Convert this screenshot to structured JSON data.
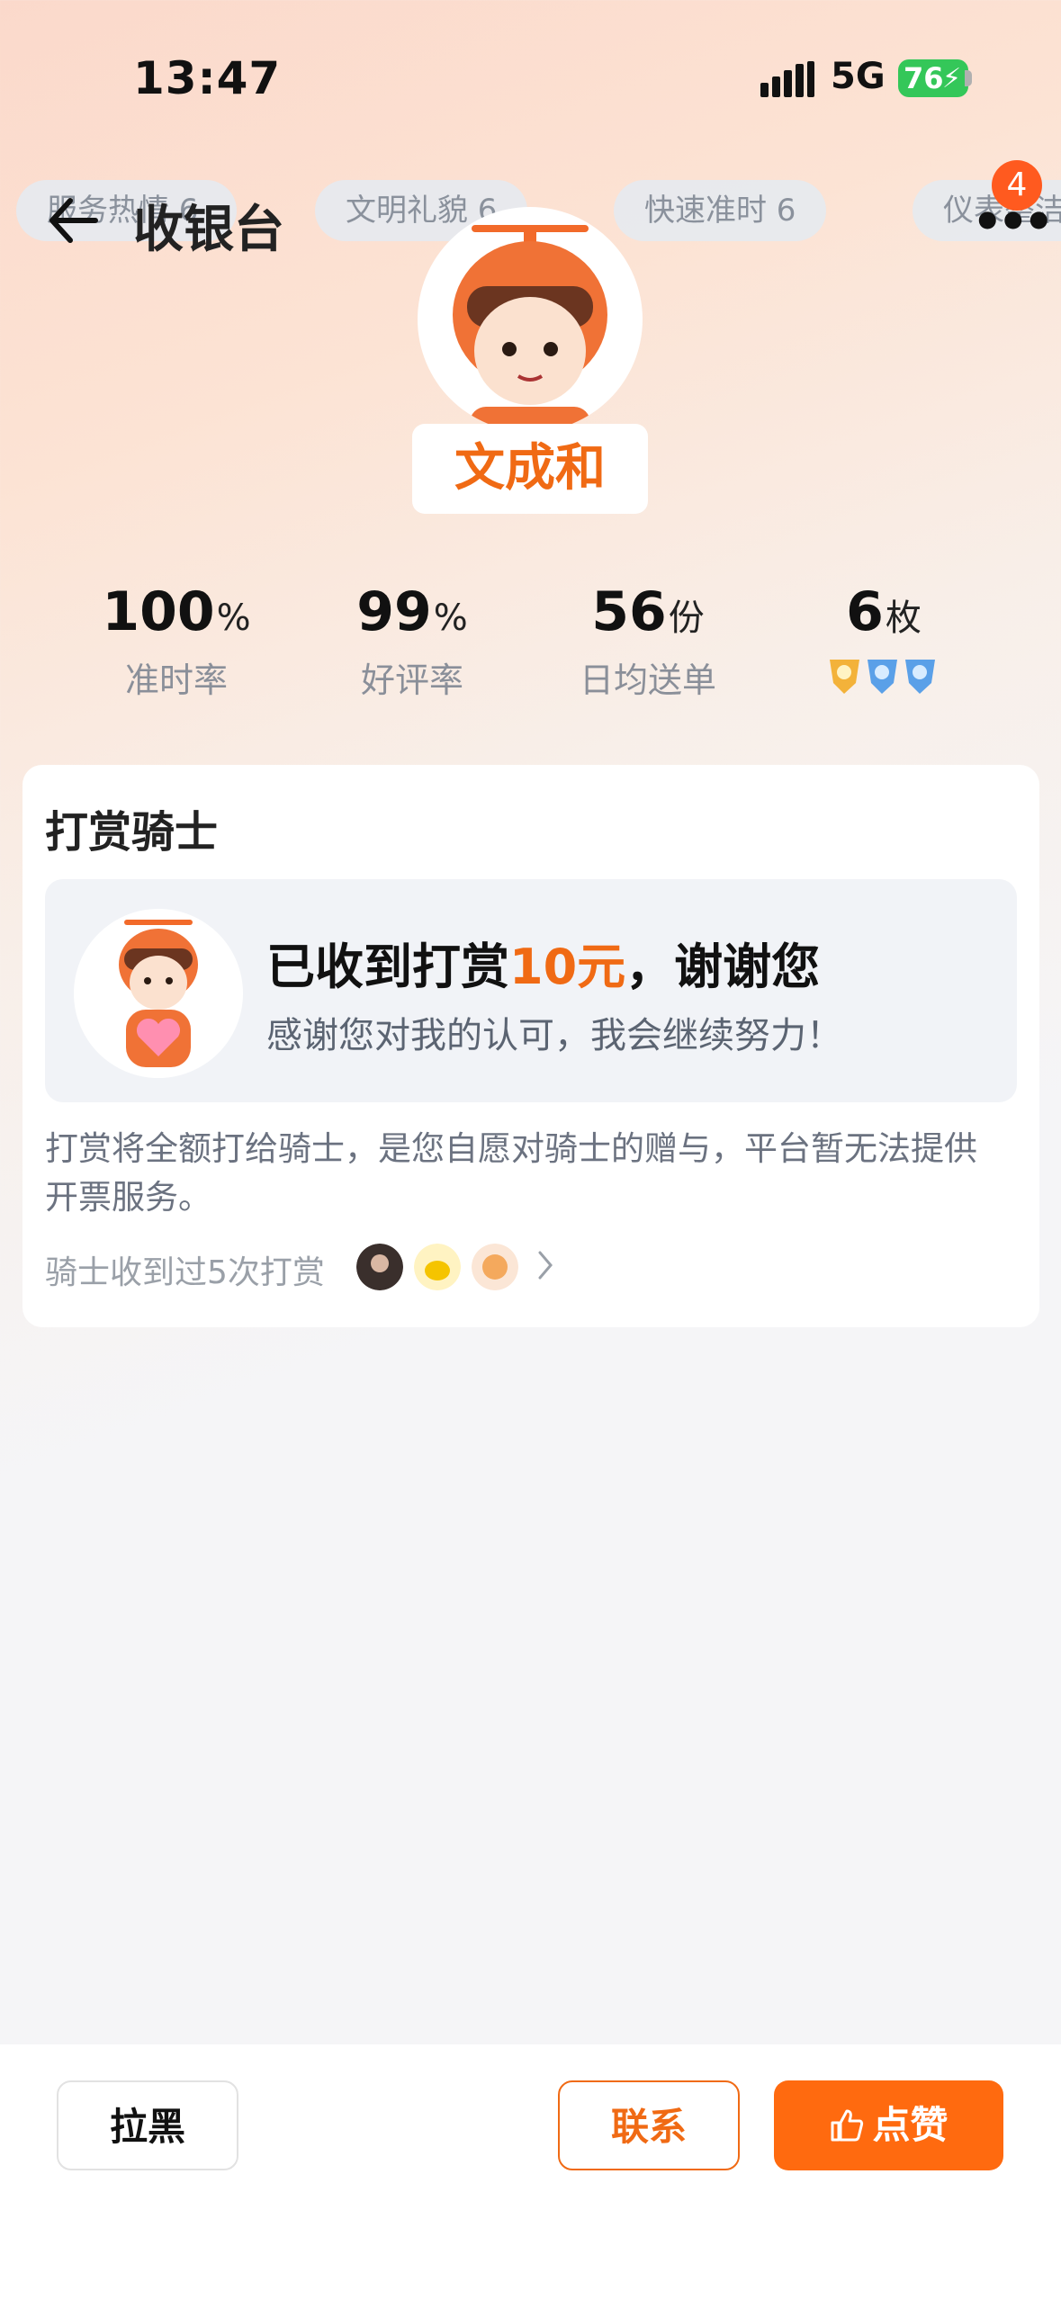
{
  "status_bar": {
    "time": "13:47",
    "network": "5G",
    "battery": "76"
  },
  "tags": [
    "服务热情 6",
    "文明礼貌 6",
    "快速准时 6",
    "仪表整洁"
  ],
  "nav": {
    "title": "收银台",
    "badge_count": "4"
  },
  "rider": {
    "name": "文成和"
  },
  "stats": [
    {
      "value": "100",
      "unit": "%",
      "label": "准时率"
    },
    {
      "value": "99",
      "unit": "%",
      "label": "好评率"
    },
    {
      "value": "56",
      "unit": "份",
      "label": "日均送单"
    },
    {
      "value": "6",
      "unit": "枚",
      "label": ""
    }
  ],
  "tip_card": {
    "title": "打赏骑士",
    "thanks_prefix": "已收到打赏",
    "thanks_amount": "10元",
    "thanks_suffix": "，谢谢您",
    "thanks_sub": "感谢您对我的认可，我会继续努力！",
    "description": "打赏将全额打给骑士，是您自愿对骑士的赠与，平台暂无法提供开票服务。",
    "tip_count_text": "骑士收到过5次打赏"
  },
  "actions": {
    "block": "拉黑",
    "contact": "联系",
    "like": "点赞"
  },
  "colors": {
    "accent": "#ff6a0f",
    "amount": "#f06a14"
  }
}
